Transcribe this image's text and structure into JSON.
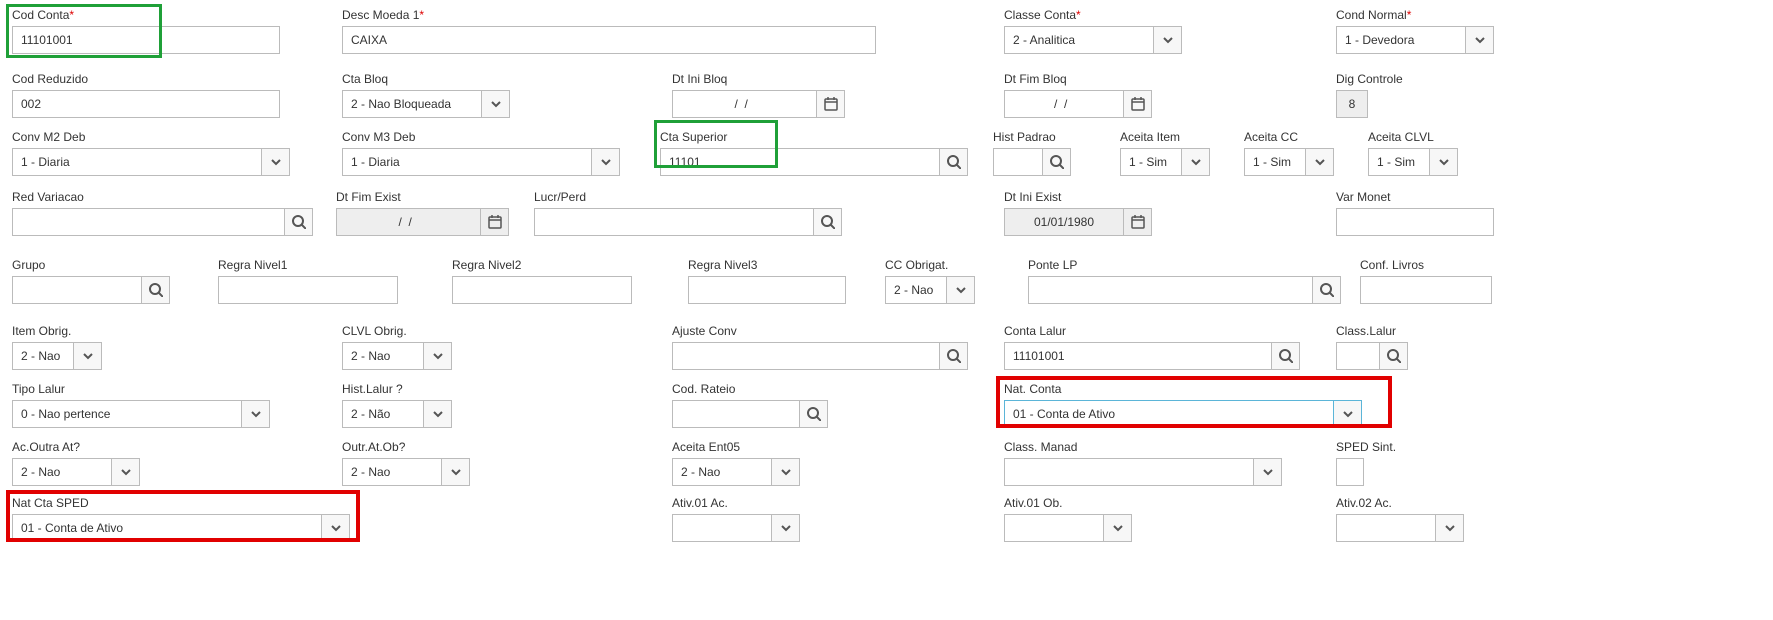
{
  "codConta": {
    "label": "Cod Conta",
    "req": "*",
    "value": "11101001"
  },
  "descMoeda1": {
    "label": "Desc Moeda 1",
    "req": "*",
    "value": "CAIXA"
  },
  "classeConta": {
    "label": "Classe Conta",
    "req": "*",
    "value": "2 - Analitica"
  },
  "condNormal": {
    "label": "Cond Normal",
    "req": "*",
    "value": "1 - Devedora"
  },
  "codReduzido": {
    "label": "Cod Reduzido",
    "value": "002"
  },
  "ctaBloq": {
    "label": "Cta Bloq",
    "value": "2 - Nao Bloqueada"
  },
  "dtIniBloq": {
    "label": "Dt Ini Bloq",
    "value": "  /  /    "
  },
  "dtFimBloq": {
    "label": "Dt Fim Bloq",
    "value": "  /  /    "
  },
  "digControle": {
    "label": "Dig Controle",
    "value": "8"
  },
  "convM2Deb": {
    "label": "Conv M2 Deb",
    "value": "1 - Diaria"
  },
  "convM3Deb": {
    "label": "Conv M3 Deb",
    "value": "1 - Diaria"
  },
  "ctaSuperior": {
    "label": "Cta Superior",
    "value": "11101"
  },
  "histPadrao": {
    "label": "Hist Padrao",
    "value": ""
  },
  "aceitaItem": {
    "label": "Aceita Item",
    "value": "1 - Sim"
  },
  "aceitaCC": {
    "label": "Aceita CC",
    "value": "1 - Sim"
  },
  "aceitaCLVL": {
    "label": "Aceita CLVL",
    "value": "1 - Sim"
  },
  "redVariacao": {
    "label": "Red Variacao",
    "value": ""
  },
  "dtFimExist": {
    "label": "Dt Fim Exist",
    "value": "  /  /    "
  },
  "lucrPerd": {
    "label": "Lucr/Perd",
    "value": ""
  },
  "dtIniExist": {
    "label": "Dt Ini Exist",
    "value": "01/01/1980"
  },
  "varMonet": {
    "label": "Var Monet",
    "value": ""
  },
  "grupo": {
    "label": "Grupo",
    "value": ""
  },
  "regraNivel1": {
    "label": "Regra Nivel1",
    "value": ""
  },
  "regraNivel2": {
    "label": "Regra Nivel2",
    "value": ""
  },
  "regraNivel3": {
    "label": "Regra Nivel3",
    "value": ""
  },
  "ccObrigat": {
    "label": "CC Obrigat.",
    "value": "2 - Nao"
  },
  "ponteLP": {
    "label": "Ponte LP",
    "value": ""
  },
  "confLivros": {
    "label": "Conf. Livros",
    "value": ""
  },
  "itemObrig": {
    "label": "Item Obrig.",
    "value": "2 - Nao"
  },
  "clvlObrig": {
    "label": "CLVL Obrig.",
    "value": "2 - Nao"
  },
  "ajusteConv": {
    "label": "Ajuste Conv",
    "value": ""
  },
  "contaLalur": {
    "label": "Conta Lalur",
    "value": "11101001"
  },
  "classLalur": {
    "label": "Class.Lalur",
    "value": ""
  },
  "tipoLalur": {
    "label": "Tipo Lalur",
    "value": "0 - Nao pertence"
  },
  "histLalur": {
    "label": "Hist.Lalur ?",
    "value": "2 - Não"
  },
  "codRateio": {
    "label": "Cod. Rateio",
    "value": ""
  },
  "natConta": {
    "label": "Nat. Conta",
    "value": "01 - Conta de Ativo"
  },
  "acOutraAt": {
    "label": "Ac.Outra At?",
    "value": "2 - Nao"
  },
  "outrAtOb": {
    "label": "Outr.At.Ob?",
    "value": "2 - Nao"
  },
  "aceitaEnt05": {
    "label": "Aceita Ent05",
    "value": "2 - Nao"
  },
  "classManad": {
    "label": "Class. Manad",
    "value": ""
  },
  "spedSint": {
    "label": "SPED Sint.",
    "value": ""
  },
  "natCtaSped": {
    "label": "Nat Cta SPED",
    "value": "01 - Conta de Ativo"
  },
  "ativ01Ac": {
    "label": "Ativ.01 Ac.",
    "value": ""
  },
  "ativ01Ob": {
    "label": "Ativ.01 Ob.",
    "value": ""
  },
  "ativ02Ac": {
    "label": "Ativ.02 Ac.",
    "value": ""
  }
}
